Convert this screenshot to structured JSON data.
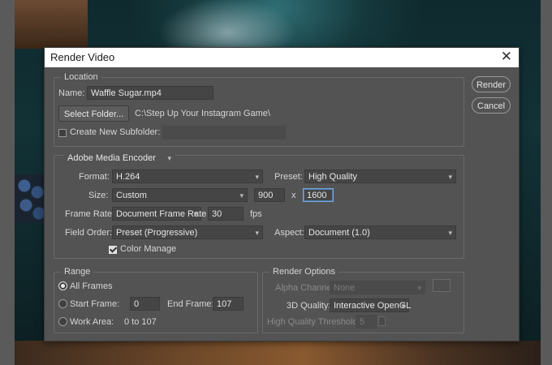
{
  "dialog": {
    "title": "Render Video",
    "render_label": "Render",
    "cancel_label": "Cancel"
  },
  "location": {
    "legend": "Location",
    "name_label": "Name:",
    "name_value": "Waffle Sugar.mp4",
    "select_folder_label": "Select Folder...",
    "folder_path": "C:\\Step Up Your Instagram Game\\",
    "subfolder_label": "Create New Subfolder:",
    "subfolder_value": "",
    "subfolder_checked": false
  },
  "encoder": {
    "encoder_value": "Adobe Media Encoder",
    "format_label": "Format:",
    "format_value": "H.264",
    "preset_label": "Preset:",
    "preset_value": "High Quality",
    "size_label": "Size:",
    "size_value": "Custom",
    "width_value": "900",
    "x_label": "x",
    "height_value": "1600",
    "frame_rate_label": "Frame Rate:",
    "frame_rate_value": "Document Frame Rate",
    "fps_value": "30",
    "fps_label": "fps",
    "field_order_label": "Field Order:",
    "field_order_value": "Preset (Progressive)",
    "aspect_label": "Aspect:",
    "aspect_value": "Document (1.0)",
    "color_manage_label": "Color Manage",
    "color_manage_checked": true
  },
  "range": {
    "legend": "Range",
    "all_frames_label": "All Frames",
    "start_frame_label": "Start Frame:",
    "start_frame_value": "0",
    "end_frame_label": "End Frame:",
    "end_frame_value": "107",
    "work_area_label": "Work Area:",
    "work_area_value": "0 to 107"
  },
  "render_options": {
    "legend": "Render Options",
    "alpha_channel_label": "Alpha Channel:",
    "alpha_channel_value": "None",
    "quality_3d_label": "3D Quality:",
    "quality_3d_value": "Interactive OpenGL",
    "hq_threshold_label": "High Quality Threshold:",
    "hq_threshold_value": "5"
  },
  "colors": {
    "dialog_bg": "#535353",
    "input_bg": "#454545",
    "focus_border": "#7aa6d8"
  }
}
